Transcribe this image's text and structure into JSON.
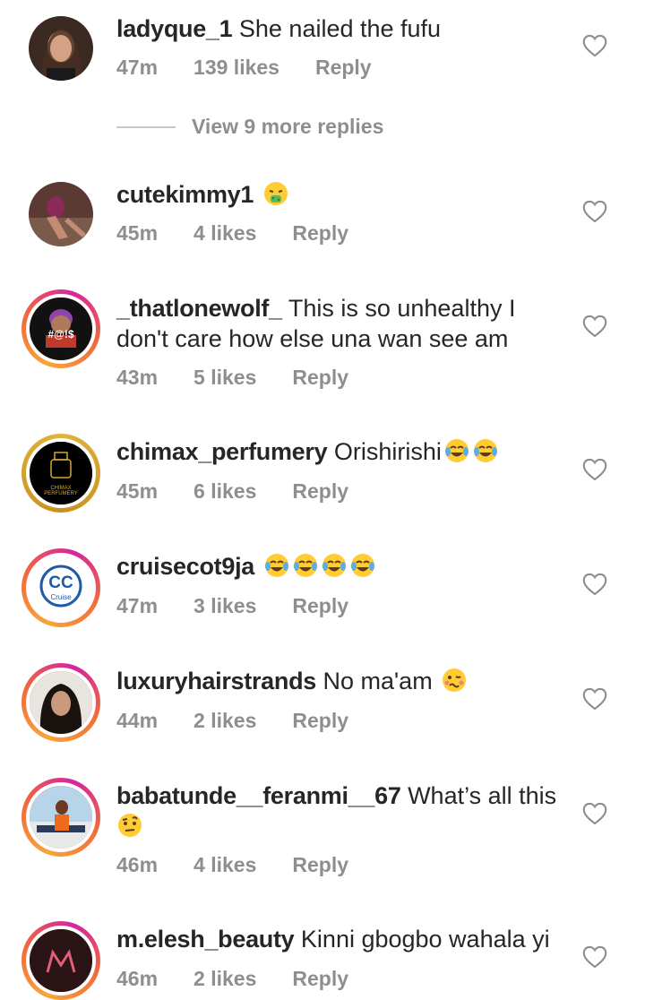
{
  "view_more": "View 9 more replies",
  "reply_label": "Reply",
  "comments": [
    {
      "username": "ladyque_1",
      "text": "She nailed the fufu",
      "time": "47m",
      "likes": "139 likes"
    },
    {
      "username": "cutekimmy1",
      "text": "",
      "emoji": "nauseated-face",
      "time": "45m",
      "likes": "4 likes"
    },
    {
      "username": "_thatlonewolf_",
      "text": "This is so unhealthy I don't care how else una wan see am",
      "time": "43m",
      "likes": "5 likes"
    },
    {
      "username": "chimax_perfumery",
      "text": "Orishirishi",
      "emoji": "tears-of-joy x2",
      "time": "45m",
      "likes": "6 likes"
    },
    {
      "username": "cruisecot9ja",
      "text": "",
      "emoji": "tears-of-joy x4",
      "time": "47m",
      "likes": "3 likes"
    },
    {
      "username": "luxuryhairstrands",
      "text": "No ma'am",
      "emoji": "woozy-face",
      "time": "44m",
      "likes": "2 likes"
    },
    {
      "username": "babatunde__feranmi__67",
      "text": "What’s all this",
      "emoji": "raised-eyebrow-face",
      "time": "46m",
      "likes": "4 likes"
    },
    {
      "username": "m.elesh_beauty",
      "text": "Kinni gbogbo wahala yi",
      "time": "46m",
      "likes": "2 likes"
    }
  ],
  "avatars": {
    "wolf_badge": "#@!$",
    "chimax_logo": "CHIMAX PERFUMERY",
    "cruise_logo": "CC",
    "cruise_sub": "Cruise"
  },
  "colors": {
    "username": "#262626",
    "meta": "#8e8e8e",
    "ring_start": "#f9a43a",
    "ring_end": "#d6249f"
  }
}
